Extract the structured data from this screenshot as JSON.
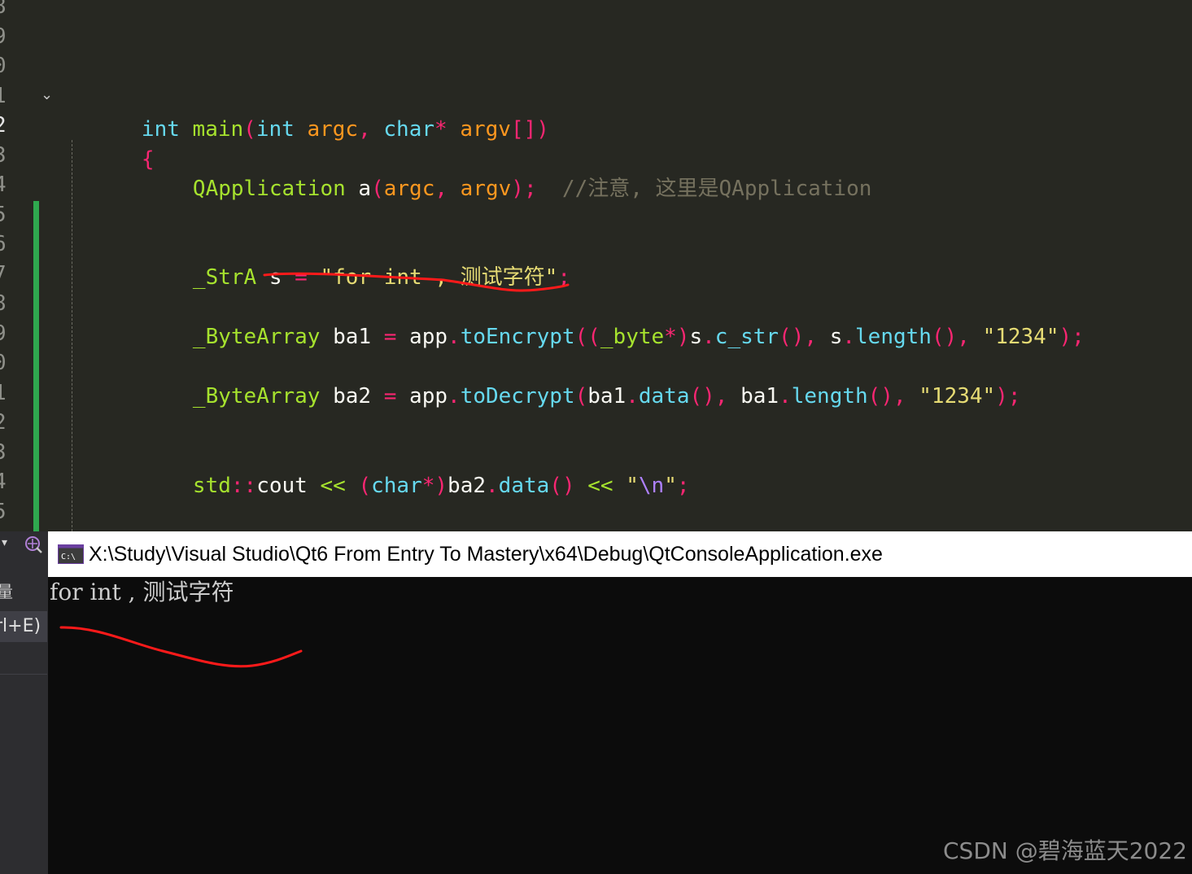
{
  "editor": {
    "line_numbers": [
      "8",
      "9",
      "0",
      "1",
      "2",
      "3",
      "4",
      "5",
      "6",
      "7",
      "8",
      "9",
      "0",
      "1",
      "2",
      "3",
      "4",
      "5"
    ],
    "current_line_index": 4,
    "lines": {
      "main_sig": {
        "t1": "int",
        "t2": " ",
        "t3": "main",
        "t4": "(",
        "t5": "int",
        "t6": " ",
        "t7": "argc",
        "t8": ", ",
        "t9": "char",
        "t10": "*",
        "t11": " ",
        "t12": "argv",
        "t13": "[])"
      },
      "open_brace": "{",
      "qapp": {
        "t1": "QApplication",
        "t2": " a",
        "t3": "(",
        "t4": "argc",
        "t5": ", ",
        "t6": "argv",
        "t7": ");",
        "t8": "  //注意, 这里是QApplication"
      },
      "stra": {
        "t1": "_StrA",
        "t2": " s ",
        "t3": "=",
        "t4": " ",
        "t5": "\"for int , 测试字符\"",
        "t6": ";"
      },
      "ba1": {
        "t1": "_ByteArray",
        "t2": " ba1 ",
        "t3": "=",
        "t4": " app",
        "t5": ".",
        "t6": "toEncrypt",
        "t7": "((",
        "t8": "_byte",
        "t9": "*)",
        "t10": "s",
        "t11": ".",
        "t12": "c_str",
        "t13": "(), ",
        "t14": "s",
        "t15": ".",
        "t16": "length",
        "t17": "(), ",
        "t18": "\"1234\"",
        "t19": ");"
      },
      "ba2": {
        "t1": "_ByteArray",
        "t2": " ba2 ",
        "t3": "=",
        "t4": " app",
        "t5": ".",
        "t6": "toDecrypt",
        "t7": "(",
        "t8": "ba1",
        "t9": ".",
        "t10": "data",
        "t11": "(), ",
        "t12": "ba1",
        "t13": ".",
        "t14": "length",
        "t15": "(), ",
        "t16": "\"1234\"",
        "t17": ");"
      },
      "cout": {
        "t1": "std",
        "t2": "::",
        "t3": "cout",
        "t4": " ",
        "t5": "<<",
        "t6": " ",
        "t7": "(",
        "t8": "char",
        "t9": "*",
        "t10": ")",
        "t11": "ba2",
        "t12": ".",
        "t13": "data",
        "t14": "()",
        "t15": " ",
        "t16": "<<",
        "t17": " ",
        "t18": "\"",
        "t19": "\\n",
        "t20": "\"",
        "t21": ";"
      }
    }
  },
  "side_panel": {
    "dropdown_icon": "caret-down-icon",
    "tool_icon": "debug-tool-icon",
    "label": "量",
    "search_hint": "rl+E)"
  },
  "console": {
    "icon": "console-app-icon",
    "title": "X:\\Study\\Visual Studio\\Qt6 From Entry To Mastery\\x64\\Debug\\QtConsoleApplication.exe",
    "output": "for int , 测试字符"
  },
  "annotation_color": "#ff1a1a",
  "watermark": "CSDN @碧海蓝天2022"
}
